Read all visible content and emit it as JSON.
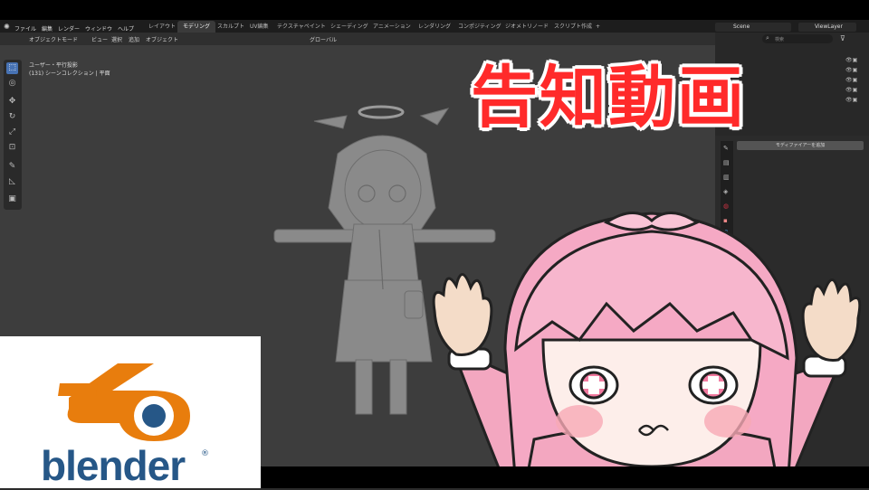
{
  "menu": [
    "ファイル",
    "編集",
    "レンダー",
    "ウィンドウ",
    "ヘルプ"
  ],
  "workspace_tabs": [
    {
      "label": "レイアウト"
    },
    {
      "label": "モデリング",
      "active": true
    },
    {
      "label": "スカルプト"
    },
    {
      "label": "UV編集"
    },
    {
      "label": "テクスチャペイント"
    },
    {
      "label": "シェーディング"
    },
    {
      "label": "アニメーション"
    },
    {
      "label": "レンダリング"
    },
    {
      "label": "コンポジティング"
    },
    {
      "label": "ジオメトリノード"
    },
    {
      "label": "スクリプト作成"
    },
    {
      "label": "+"
    }
  ],
  "scene": "Scene",
  "view_layer": "ViewLayer",
  "header": {
    "mode": "オブジェクトモード",
    "view": "ビュー",
    "select": "選択",
    "add": "追加",
    "object": "オブジェクト",
    "orientation": "グローバル",
    "search_placeholder": "検索"
  },
  "viewport_info": {
    "line1": "ユーザー・平行投影",
    "line2": "(131) シーンコレクション | 平面"
  },
  "properties": {
    "add_modifier": "モディファイアーを追加"
  },
  "overlay_title": "告知動画",
  "logo_text": "blender",
  "logo_reg": "®",
  "colors": {
    "title_red": "#ff2a2a",
    "blender_orange": "#e87d0d",
    "blender_blue": "#265787",
    "active_blue": "#4772b3"
  },
  "icons": [
    "blender-icon",
    "select-icon",
    "cursor-icon",
    "move-icon",
    "rotate-icon",
    "scale-icon",
    "transform-icon",
    "annotate-icon",
    "measure-icon",
    "add-cube-icon",
    "eye-icon",
    "camera-icon",
    "wrench-icon",
    "search-icon",
    "filter-icon"
  ]
}
